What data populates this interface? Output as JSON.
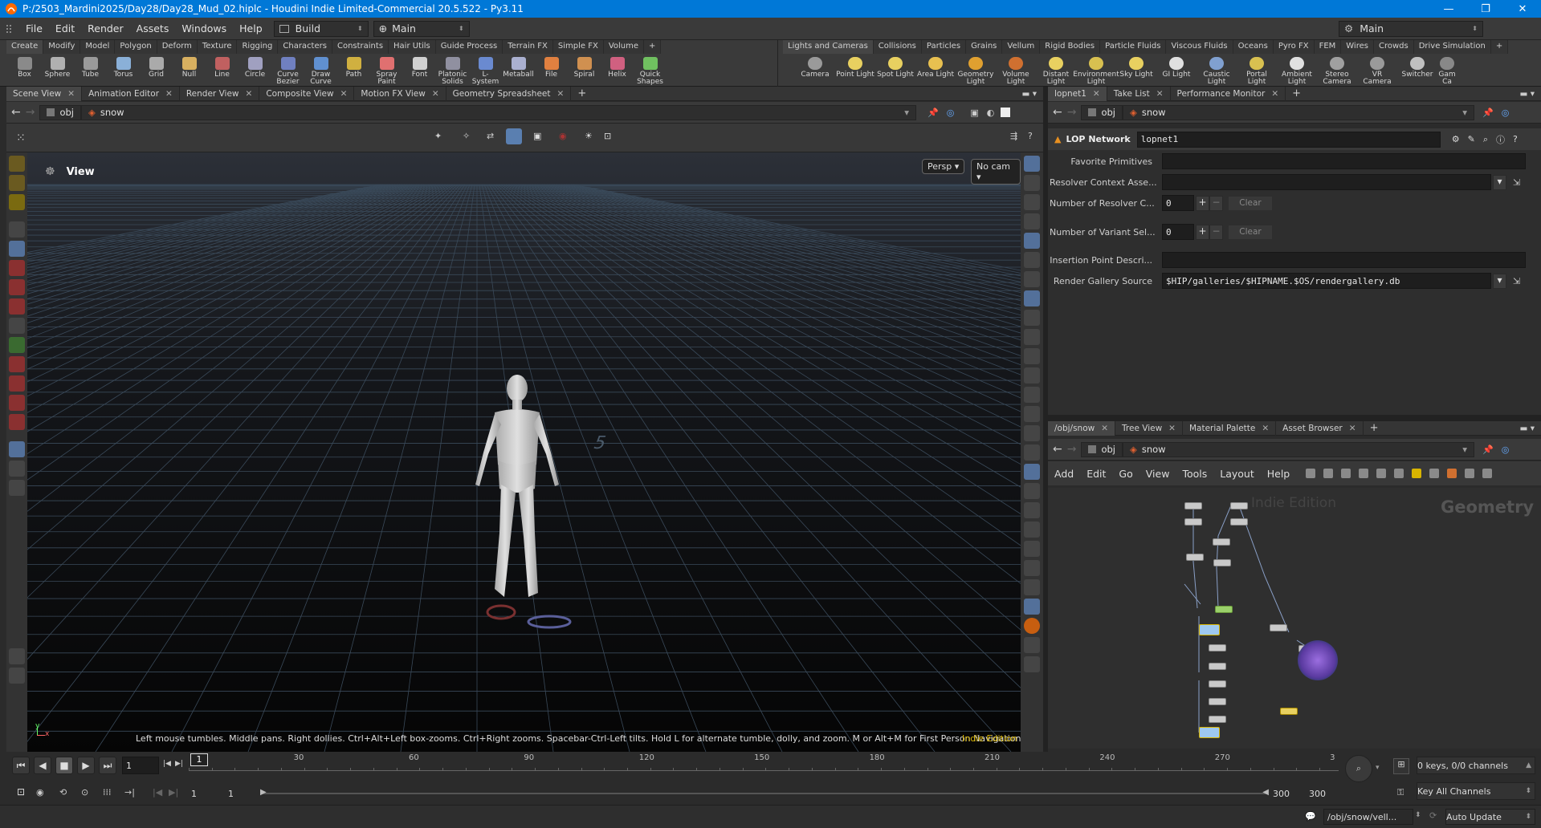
{
  "window": {
    "title": "P:/2503_Mardini2025/Day28/Day28_Mud_02.hiplc - Houdini Indie Limited-Commercial 20.5.522 - Py3.11",
    "minimize": "—",
    "maximize": "❐",
    "close": "✕"
  },
  "menubar": {
    "items": [
      "File",
      "Edit",
      "Render",
      "Assets",
      "Windows",
      "Help"
    ],
    "desktop": "Build",
    "context": "Main",
    "right_context": "Main"
  },
  "shelf_left": {
    "tabs": [
      "Create",
      "Modify",
      "Model",
      "Polygon",
      "Deform",
      "Texture",
      "Rigging",
      "Characters",
      "Constraints",
      "Hair Utils",
      "Guide Process",
      "Terrain FX",
      "Simple FX",
      "Volume",
      "+"
    ],
    "tools": [
      {
        "label": "Box",
        "icon": "box-icon"
      },
      {
        "label": "Sphere",
        "icon": "sphere-icon"
      },
      {
        "label": "Tube",
        "icon": "tube-icon"
      },
      {
        "label": "Torus",
        "icon": "torus-icon"
      },
      {
        "label": "Grid",
        "icon": "grid-icon"
      },
      {
        "label": "Null",
        "icon": "null-icon"
      },
      {
        "label": "Line",
        "icon": "line-icon"
      },
      {
        "label": "Circle",
        "icon": "circle-icon"
      },
      {
        "label": "Curve Bezier",
        "icon": "curve-bezier-icon"
      },
      {
        "label": "Draw Curve",
        "icon": "draw-curve-icon"
      },
      {
        "label": "Path",
        "icon": "path-icon"
      },
      {
        "label": "Spray Paint",
        "icon": "spray-paint-icon"
      },
      {
        "label": "Font",
        "icon": "font-icon"
      },
      {
        "label": "Platonic Solids",
        "icon": "platonic-icon"
      },
      {
        "label": "L-System",
        "icon": "lsystem-icon"
      },
      {
        "label": "Metaball",
        "icon": "metaball-icon"
      },
      {
        "label": "File",
        "icon": "file-icon"
      },
      {
        "label": "Spiral",
        "icon": "spiral-icon"
      },
      {
        "label": "Helix",
        "icon": "helix-icon"
      },
      {
        "label": "Quick Shapes",
        "icon": "quick-shapes-icon"
      }
    ]
  },
  "shelf_right": {
    "tabs": [
      "Lights and Cameras",
      "Collisions",
      "Particles",
      "Grains",
      "Vellum",
      "Rigid Bodies",
      "Particle Fluids",
      "Viscous Fluids",
      "Oceans",
      "Pyro FX",
      "FEM",
      "Wires",
      "Crowds",
      "Drive Simulation",
      "+"
    ],
    "tools": [
      {
        "label": "Camera",
        "icon": "camera-icon"
      },
      {
        "label": "Point Light",
        "icon": "point-light-icon"
      },
      {
        "label": "Spot Light",
        "icon": "spot-light-icon"
      },
      {
        "label": "Area Light",
        "icon": "area-light-icon"
      },
      {
        "label": "Geometry Light",
        "icon": "geometry-light-icon"
      },
      {
        "label": "Volume Light",
        "icon": "volume-light-icon"
      },
      {
        "label": "Distant Light",
        "icon": "distant-light-icon"
      },
      {
        "label": "Environment Light",
        "icon": "environment-light-icon"
      },
      {
        "label": "Sky Light",
        "icon": "sky-light-icon"
      },
      {
        "label": "GI Light",
        "icon": "gi-light-icon"
      },
      {
        "label": "Caustic Light",
        "icon": "caustic-light-icon"
      },
      {
        "label": "Portal Light",
        "icon": "portal-light-icon"
      },
      {
        "label": "Ambient Light",
        "icon": "ambient-light-icon"
      },
      {
        "label": "Stereo Camera",
        "icon": "stereo-camera-icon"
      },
      {
        "label": "VR Camera",
        "icon": "vr-camera-icon"
      },
      {
        "label": "Switcher",
        "icon": "switcher-icon"
      },
      {
        "label": "Gam Ca",
        "icon": "gamepad-camera-icon"
      }
    ]
  },
  "left_pane": {
    "tabs": [
      "Scene View",
      "Animation Editor",
      "Render View",
      "Composite View",
      "Motion FX View",
      "Geometry Spreadsheet"
    ],
    "path_root": "obj",
    "path_node": "snow"
  },
  "viewport": {
    "label": "View",
    "persp": "Persp",
    "cam": "No cam",
    "hint": "Left mouse tumbles. Middle pans. Right dollies. Ctrl+Alt+Left box-zooms. Ctrl+Right zooms. Spacebar-Ctrl-Left tilts. Hold L for alternate tumble, dolly, and zoom. M or Alt+M for First Person Navigation.",
    "edition": "Indie Edition",
    "grid_number": "5"
  },
  "param_pane": {
    "tabs": [
      "lopnet1",
      "Take List",
      "Performance Monitor"
    ],
    "path_root": "obj",
    "path_node": "snow",
    "network_type": "LOP Network",
    "network_name": "lopnet1",
    "params": {
      "favorite_primitives": "Favorite Primitives",
      "resolver_context": "Resolver Context Asse...",
      "num_resolver": "Number of Resolver C...",
      "num_resolver_value": "0",
      "num_variant": "Number of Variant Sel...",
      "num_variant_value": "0",
      "insertion_point": "Insertion Point Descri...",
      "render_gallery": "Render Gallery Source",
      "render_gallery_value": "$HIP/galleries/$HIPNAME.$OS/rendergallery.db",
      "clear": "Clear",
      "plus": "+",
      "minus": "−"
    }
  },
  "network_pane": {
    "tabs": [
      "/obj/snow",
      "Tree View",
      "Material Palette",
      "Asset Browser"
    ],
    "path_root": "obj",
    "path_node": "snow",
    "menu": [
      "Add",
      "Edit",
      "Go",
      "View",
      "Tools",
      "Layout",
      "Help"
    ],
    "watermark": "Indie Edition",
    "context_label": "Geometry"
  },
  "timeline": {
    "current_frame": "1",
    "frame_marker": "1",
    "ticks": [
      "30",
      "60",
      "90",
      "120",
      "150",
      "180",
      "210",
      "240",
      "270",
      "3"
    ],
    "start": "1",
    "start2": "1",
    "end": "300",
    "end2": "300",
    "keys_info": "0 keys, 0/0 channels",
    "key_all": "Key All Channels"
  },
  "statusbar": {
    "path": "/obj/snow/vell...",
    "update_mode": "Auto Update"
  },
  "colors": {
    "title_bar": "#0078d7",
    "accent_yellow": "#d8b400"
  }
}
